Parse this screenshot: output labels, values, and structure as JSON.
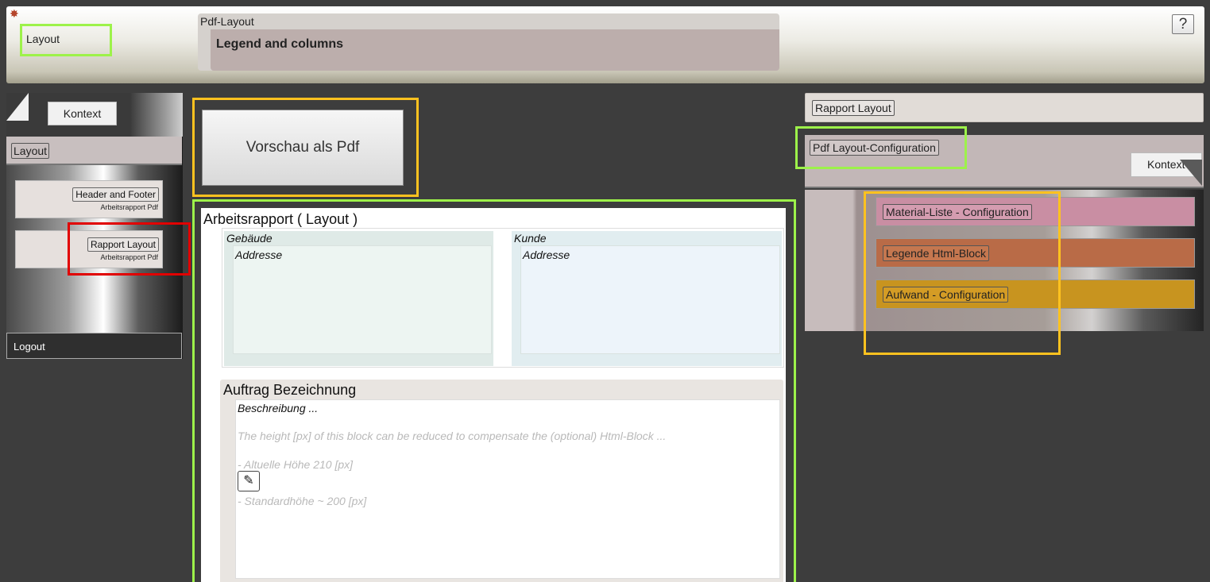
{
  "header": {
    "layout_label": "Layout",
    "section_label": "Pdf-Layout",
    "section_title": "Legend and columns",
    "help_label": "?"
  },
  "sidebar": {
    "kontext_label": "Kontext",
    "layout_label": "Layout",
    "items": [
      {
        "label": "Header and Footer",
        "sub": "Arbeitsrapport Pdf"
      },
      {
        "label": "Rapport Layout",
        "sub": "Arbeitsrapport Pdf"
      }
    ],
    "logout_label": "Logout"
  },
  "main": {
    "preview_label": "Vorschau als Pdf",
    "doc_title": "Arbeitsrapport ( Layout )",
    "blocks": [
      {
        "title": "Gebäude",
        "field": "Addresse",
        "color": "#dfeae7",
        "inner": "#edf5f2"
      },
      {
        "title": "Kunde",
        "field": "Addresse",
        "color": "#e1edf0",
        "inner": "#edf4fa"
      }
    ],
    "auftrag": {
      "title": "Auftrag Bezeichnung",
      "description": "Beschreibung ...",
      "hint": "The height [px] of this block can be reduced to compensate the (optional) Html-Block ...",
      "current_height": "- Altuelle Höhe 210 [px]",
      "default_height": "- Standardhöhe ~ 200 [px]",
      "edit_icon": "pencil-icon"
    }
  },
  "right": {
    "rapport_label": "Rapport Layout",
    "config_label": "Pdf Layout-Configuration",
    "kontext_label": "Kontext",
    "items": [
      {
        "label": "Material-Liste - Configuration",
        "color": "#c98ea3",
        "btn": "#d49cb0"
      },
      {
        "label": "Legende Html-Block",
        "color": "#b96b47",
        "btn": "#c5774f"
      },
      {
        "label": "Aufwand - Configuration",
        "color": "#c8941f",
        "btn": "#d49c25"
      }
    ]
  }
}
